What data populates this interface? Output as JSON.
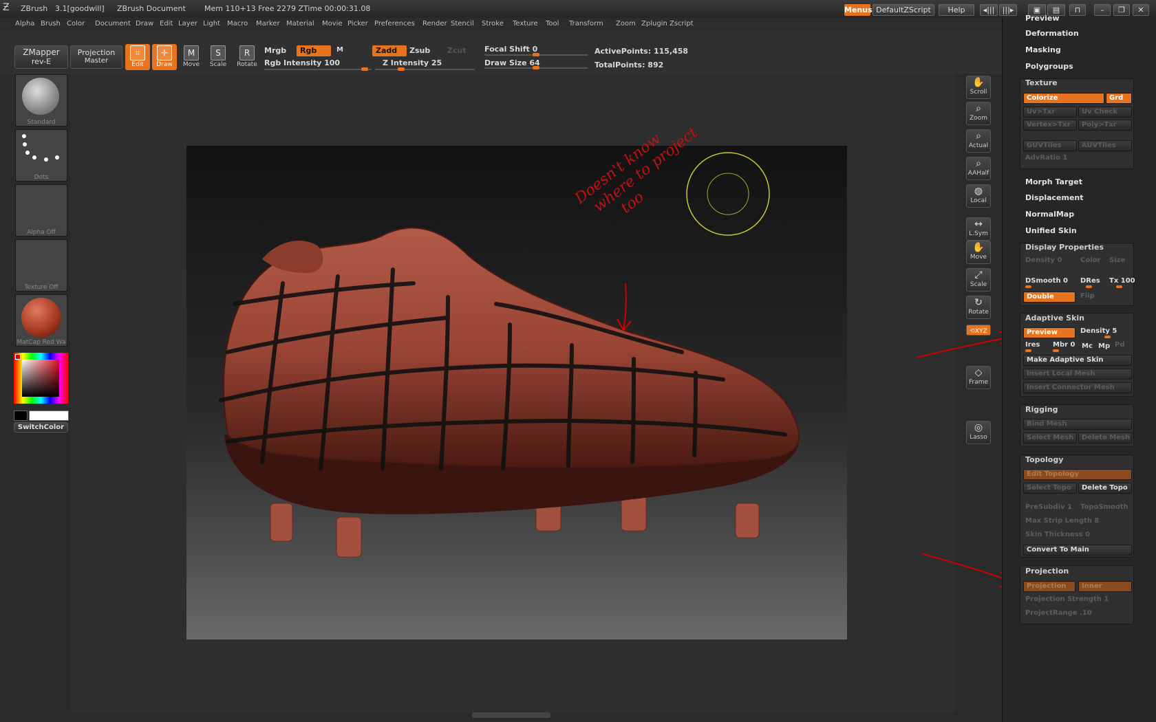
{
  "titlebar": {
    "app": "ZBrush",
    "version": "3.1[goodwill]",
    "doc": "ZBrush Document",
    "mem": "Mem 110+13 Free 2279 ZTime 00:00:31.08",
    "menus_btn": "Menus",
    "script_btn": "DefaultZScript",
    "help_btn": "Help"
  },
  "menubar": [
    "Alpha",
    "Brush",
    "Color",
    "Document",
    "Draw",
    "Edit",
    "Layer",
    "Light",
    "Macro",
    "Marker",
    "Material",
    "Movie",
    "Picker",
    "Preferences",
    "Render",
    "Stencil",
    "Stroke",
    "Texture",
    "Tool",
    "Transform",
    "Zoom",
    "Zplugin",
    "Zscript"
  ],
  "toolbar": {
    "zmapper": "ZMapper",
    "zmapper_sub": "rev-E",
    "projection": "Projection",
    "projection_sub": "Master",
    "edit": "Edit",
    "draw": "Draw",
    "move": "Move",
    "scale": "Scale",
    "rotate": "Rotate",
    "mrgb": "Mrgb",
    "rgb": "Rgb",
    "m": "M",
    "rgb_intensity": "Rgb Intensity 100",
    "zadd": "Zadd",
    "zsub": "Zsub",
    "zcut": "Zcut",
    "z_intensity": "Z Intensity 25",
    "focal_shift": "Focal Shift 0",
    "draw_size": "Draw Size 64",
    "active_points": "ActivePoints: 115,458",
    "total_points": "TotalPoints: 892"
  },
  "left_shelf": {
    "brush": "Standard",
    "stroke": "Dots",
    "alpha": "Alpha  Off",
    "texture": "Texture  Off",
    "material": "MatCap  Red  Wa",
    "switch_color": "SwitchColor"
  },
  "annotation": {
    "text_line1": "Doesn't know",
    "text_line2": "where to project",
    "text_line3": "too"
  },
  "right_shelf": [
    "Scroll",
    "Zoom",
    "Actual",
    "AAHalf",
    "Local",
    "L.Sym",
    "Move",
    "Scale",
    "Rotate",
    "XYZ",
    "Frame",
    "Lasso"
  ],
  "right_panel": {
    "top_items": [
      "Preview",
      "Deformation",
      "Masking",
      "Polygroups"
    ],
    "texture": {
      "header": "Texture",
      "colorize": "Colorize",
      "grd": "Grd",
      "buttons": [
        "Uv>Txr",
        "Uv Check",
        "Vertex>Txr",
        "Poly>Txr",
        "GUVTiles",
        "AUVTiles"
      ],
      "advratio": "AdvRatio 1"
    },
    "mid_items": [
      "Morph Target",
      "Displacement",
      "NormalMap",
      "Unified Skin"
    ],
    "display": {
      "header": "Display Properties",
      "density": "Density 0",
      "color": "Color",
      "size": "Size",
      "dsmooth": "DSmooth 0",
      "dres": "DRes",
      "tx": "Tx 100",
      "double": "Double",
      "flip": "Flip"
    },
    "adaptive": {
      "header": "Adaptive Skin",
      "preview": "Preview",
      "density": "Density 5",
      "ires": "Ires",
      "mbr": "Mbr 0",
      "mc": "Mc",
      "mp": "Mp",
      "pd": "Pd",
      "make": "Make Adaptive Skin",
      "local": "Insert Local Mesh",
      "connector": "Insert Connector Mesh"
    },
    "rigging": {
      "header": "Rigging",
      "bind": "Bind Mesh",
      "select": "Select Mesh",
      "delete": "Delete Mesh"
    },
    "topology": {
      "header": "Topology",
      "edit": "Edit Topology",
      "select": "Select Topo",
      "delete": "Delete Topo",
      "presubdiv": "PreSubdiv 1",
      "toposmooth": "TopoSmooth",
      "max_strip": "Max Strip Length 8",
      "skin": "Skin Thickness 0",
      "convert": "Convert To Main"
    },
    "projection": {
      "header": "Projection",
      "btn1": "Projection",
      "btn2": "Inner",
      "strength": "Projection Strength 1",
      "range": "ProjectRange .10"
    }
  }
}
